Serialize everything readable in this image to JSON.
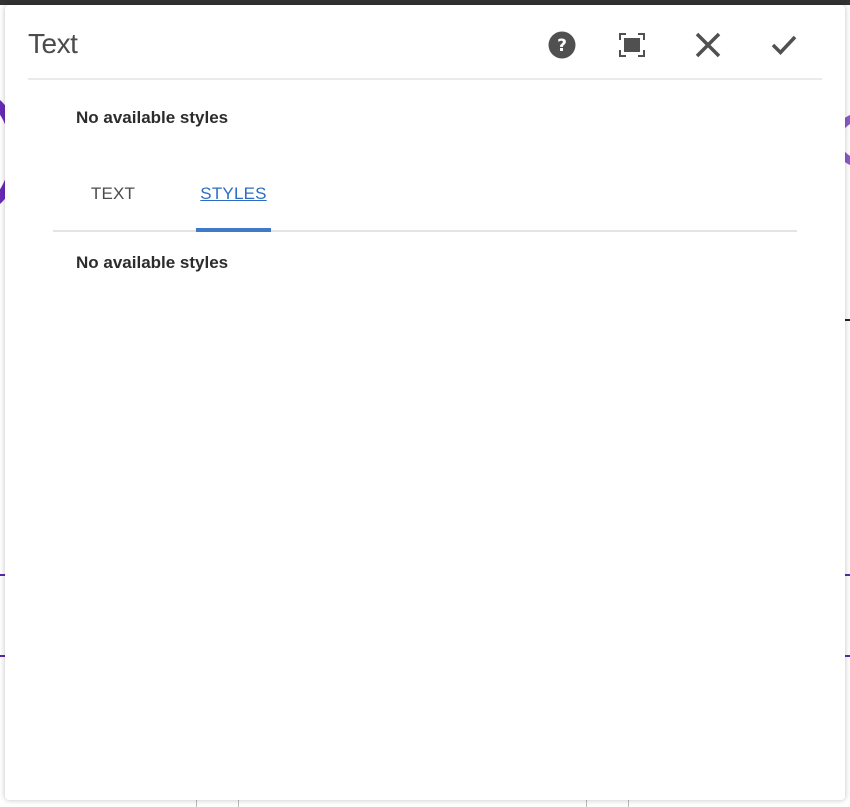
{
  "dialog": {
    "title": "Text",
    "actions": {
      "help": "help-icon",
      "fullscreen": "fullscreen-icon",
      "close": "close-icon",
      "done": "checkmark-icon"
    },
    "top_message": "No available styles",
    "tabs": [
      {
        "label": "TEXT",
        "selected": false
      },
      {
        "label": "STYLES",
        "selected": true
      }
    ],
    "panel_message": "No available styles"
  },
  "colors": {
    "accent": "#3f79c8",
    "icon": "#505050",
    "title": "#4b4b4b"
  }
}
